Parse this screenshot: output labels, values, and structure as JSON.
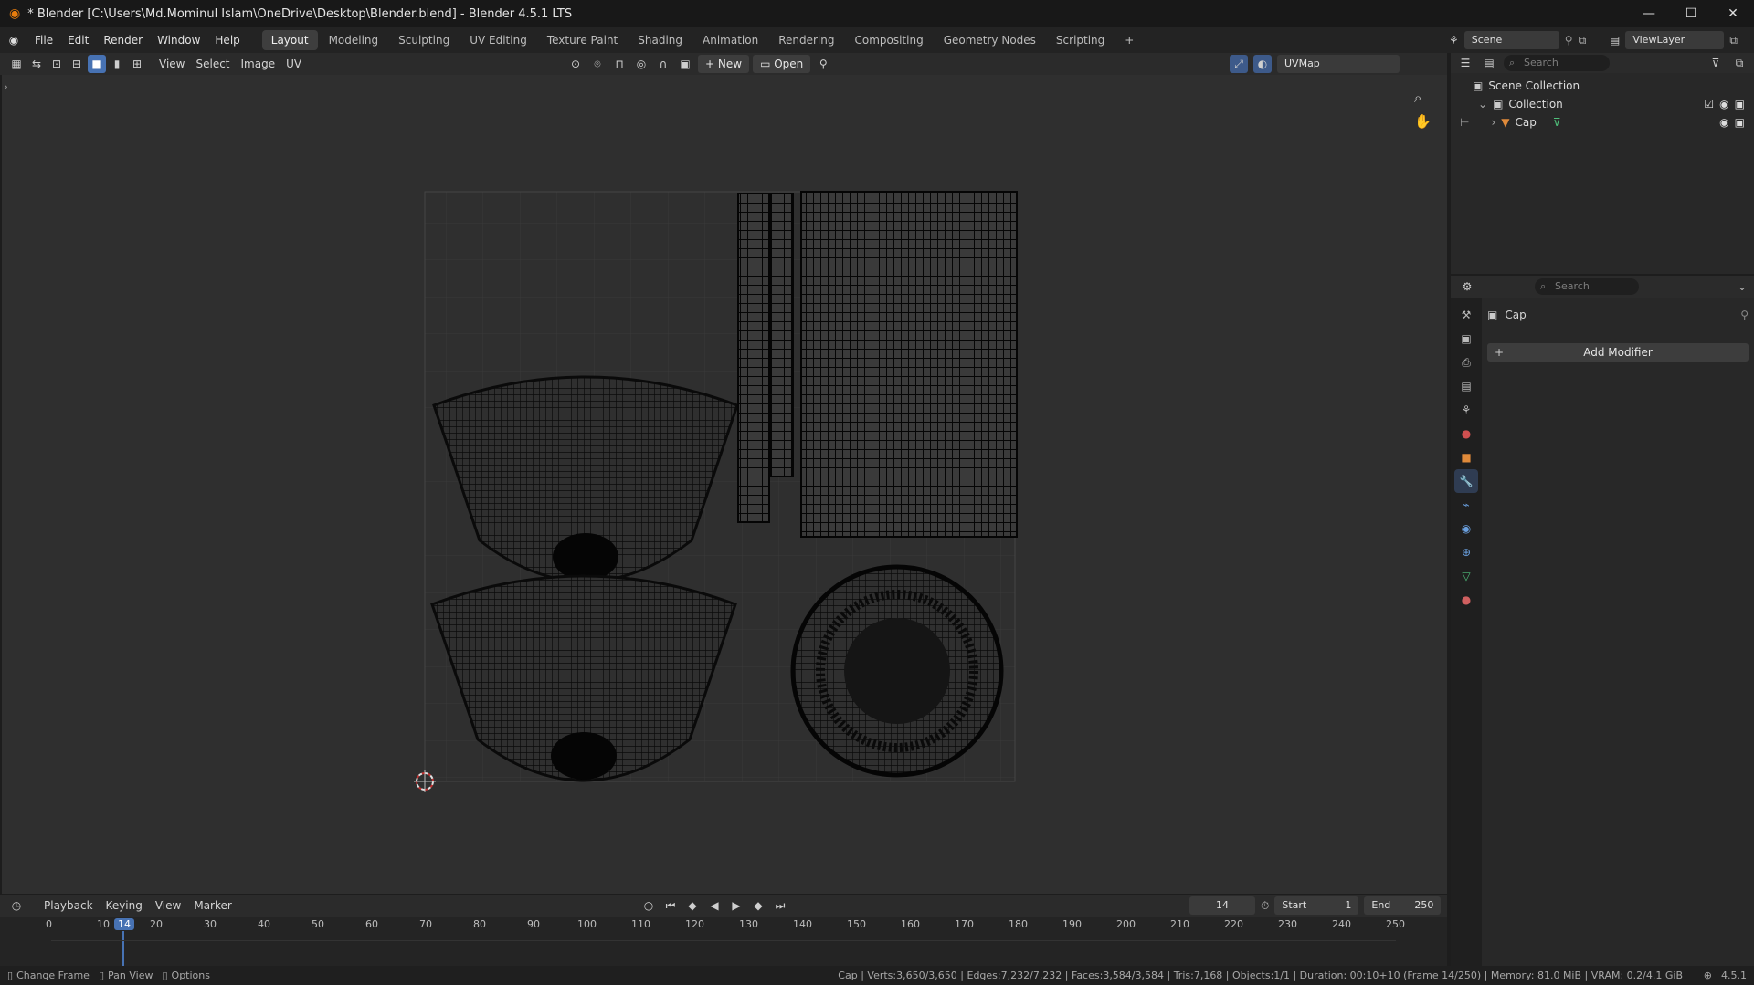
{
  "titlebar": {
    "title": "* Blender [C:\\Users\\Md.Mominul Islam\\OneDrive\\Desktop\\Blender.blend] - Blender 4.5.1 LTS",
    "minimize": "—",
    "maximize": "☐",
    "close": "✕"
  },
  "menubar": {
    "menus": [
      "File",
      "Edit",
      "Render",
      "Window",
      "Help"
    ],
    "workspaces": [
      "Layout",
      "Modeling",
      "Sculpting",
      "UV Editing",
      "Texture Paint",
      "Shading",
      "Animation",
      "Rendering",
      "Compositing",
      "Geometry Nodes",
      "Scripting"
    ],
    "active_workspace": "Layout",
    "add_tab": "+",
    "scene_label": "Scene",
    "viewlayer_label": "ViewLayer"
  },
  "uv_header": {
    "menus": [
      "View",
      "Select",
      "Image",
      "UV"
    ],
    "new_button": "New",
    "open_button": "Open",
    "uvmap": "UVMap"
  },
  "outliner": {
    "search_placeholder": "Search",
    "scene_collection": "Scene Collection",
    "collection": "Collection",
    "object": "Cap"
  },
  "properties": {
    "search_placeholder": "Search",
    "object_name": "Cap",
    "add_modifier": "Add Modifier"
  },
  "timeline": {
    "menus": [
      "Playback",
      "Keying",
      "View",
      "Marker"
    ],
    "current_frame": "14",
    "start_label": "Start",
    "start_value": "1",
    "end_label": "End",
    "end_value": "250",
    "ticks": [
      "0",
      "10",
      "14",
      "20",
      "30",
      "40",
      "50",
      "60",
      "70",
      "80",
      "90",
      "100",
      "110",
      "120",
      "130",
      "140",
      "150",
      "160",
      "170",
      "180",
      "190",
      "200",
      "210",
      "220",
      "230",
      "240",
      "250"
    ]
  },
  "statusbar": {
    "hint_left": "Change Frame",
    "hint_mid": "Pan View",
    "hint_right": "Options",
    "stats": "Cap | Verts:3,650/3,650 | Edges:7,232/7,232 | Faces:3,584/3,584 | Tris:7,168 | Objects:1/1 | Duration: 00:10+10 (Frame 14/250) | Memory: 81.0 MiB | VRAM: 0.2/4.1 GiB",
    "version": "4.5.1"
  },
  "colors": {
    "accent_active_frame": "#4772b3",
    "uv_canvas": "#2f2f2f",
    "uv_wire": "#0a0a0a",
    "object_orange": "#e08a3a",
    "mesh_green": "#4fbf7a"
  }
}
